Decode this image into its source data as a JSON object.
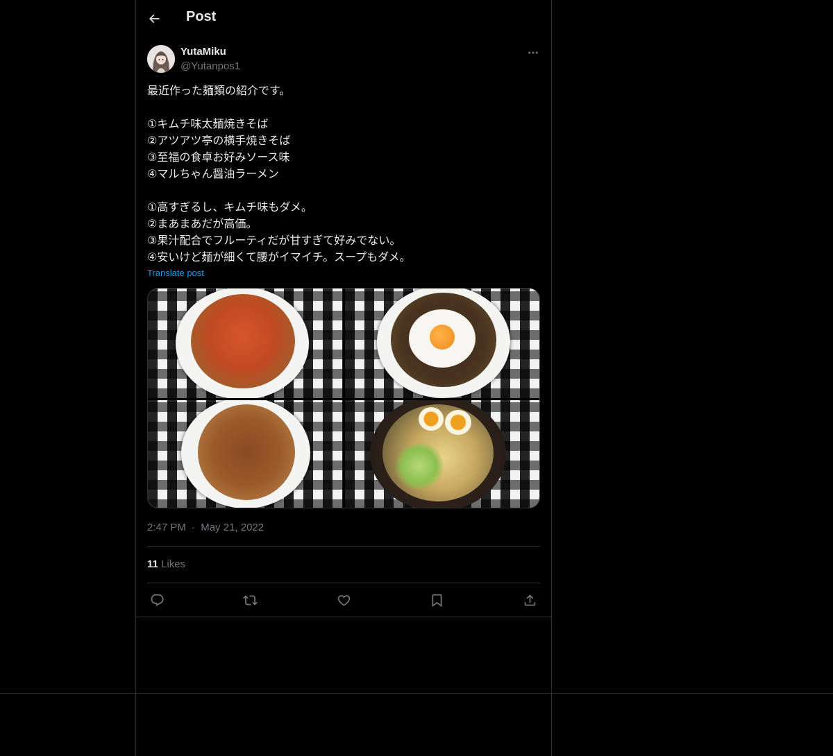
{
  "header": {
    "title": "Post"
  },
  "user": {
    "name": "YutaMiku",
    "handle": "@Yutanpos1"
  },
  "tweet": {
    "lines": [
      "最近作った麺類の紹介です。",
      "",
      "①キムチ味太麺焼きそば",
      "②アツアツ亭の横手焼きそば",
      "③至福の食卓お好みソース味",
      "④マルちゃん醤油ラーメン",
      "",
      "①高すぎるし、キムチ味もダメ。",
      "②まあまあだが高価。",
      "③果汁配合でフルーティだが甘すぎて好みでない。",
      "④安いけど麺が細くて腰がイマイチ。スープもダメ。"
    ],
    "translate_label": "Translate post",
    "time": "2:47 PM",
    "separator": "·",
    "date": "May 21, 2022"
  },
  "stats": {
    "likes_count": "11",
    "likes_label": "Likes"
  },
  "icons": {
    "back": "arrow-left-icon",
    "more": "more-horizontal-icon",
    "reply": "reply-icon",
    "retweet": "retweet-icon",
    "like": "heart-icon",
    "bookmark": "bookmark-icon",
    "share": "share-icon"
  },
  "colors": {
    "background": "#000000",
    "text": "#e7e9ea",
    "muted": "#71767b",
    "link": "#1d9bf0",
    "border": "#2f3336"
  }
}
